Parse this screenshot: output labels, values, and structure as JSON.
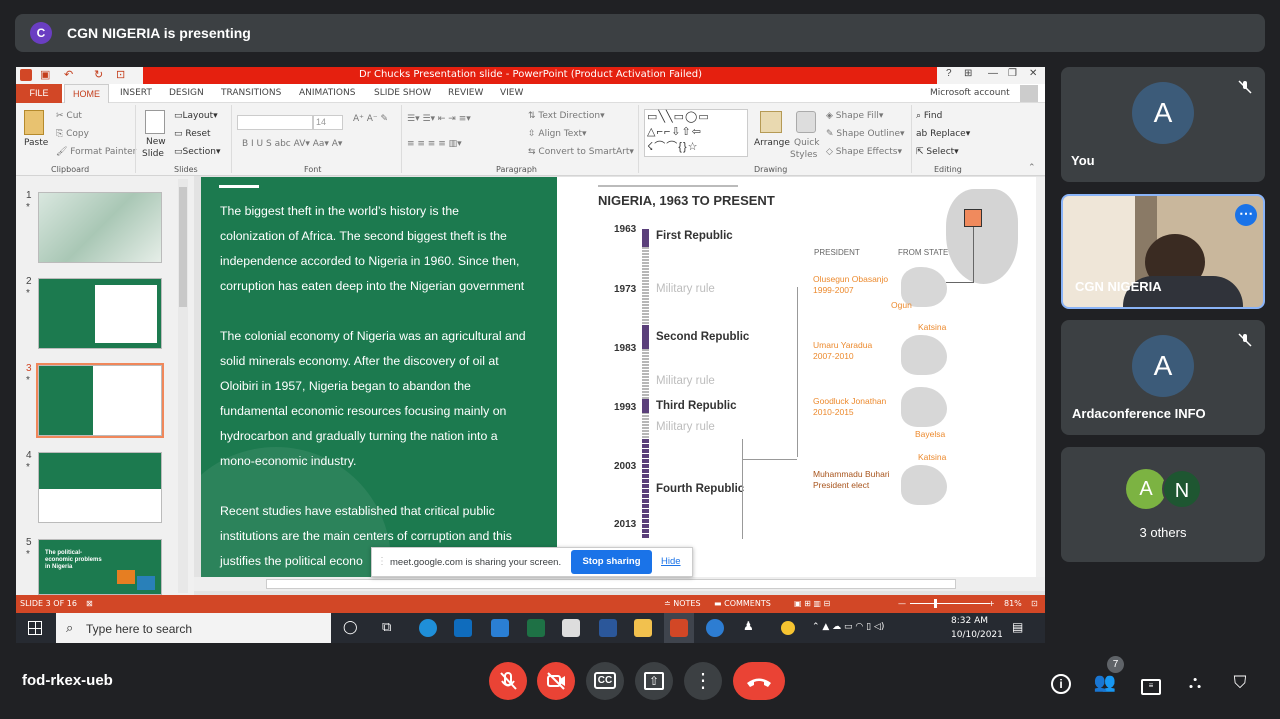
{
  "meet": {
    "presenter_initial": "C",
    "presenting_text": "CGN NIGERIA is presenting",
    "meeting_code": "fod-rkex-ueb",
    "participant_count": "7"
  },
  "participants": [
    {
      "initial": "A",
      "label": "You"
    },
    {
      "label": "CGN NIGERIA"
    },
    {
      "initial": "A",
      "label": "Ardaconference INFO"
    },
    {
      "initials": [
        "A",
        "N"
      ],
      "label": "3 others"
    }
  ],
  "ppt": {
    "window_title": "Dr Chucks Presentation slide -  PowerPoint (Product Activation Failed)",
    "account": "Microsoft account",
    "tabs": [
      "FILE",
      "HOME",
      "INSERT",
      "DESIGN",
      "TRANSITIONS",
      "ANIMATIONS",
      "SLIDE SHOW",
      "REVIEW",
      "VIEW"
    ],
    "ribbon": {
      "paste": "Paste",
      "cut": "Cut",
      "copy": "Copy",
      "format_painter": "Format Painter",
      "new_slide_1": "New",
      "new_slide_2": "Slide",
      "layout": "Layout",
      "reset": "Reset",
      "section": "Section",
      "font_size": "14",
      "text_direction": "Text Direction",
      "align_text": "Align Text",
      "convert_smartart": "Convert to SmartArt",
      "arrange": "Arrange",
      "quick_styles_1": "Quick",
      "quick_styles_2": "Styles",
      "shape_fill": "Shape Fill",
      "shape_outline": "Shape Outline",
      "shape_effects": "Shape Effects",
      "find": "Find",
      "replace": "Replace",
      "select": "Select",
      "groups": [
        "Clipboard",
        "Slides",
        "Font",
        "Paragraph",
        "Drawing",
        "Editing"
      ]
    },
    "thumbnails": [
      {
        "num": "1",
        "star": "*"
      },
      {
        "num": "2",
        "star": "*"
      },
      {
        "num": "3",
        "star": "*"
      },
      {
        "num": "4",
        "star": "*"
      },
      {
        "num": "5",
        "star": "*",
        "text": "The political-economic problems in Nigeria"
      }
    ],
    "slide": {
      "paragraph1": [
        "The biggest theft in the world’s history is the",
        "colonization of Africa. The second biggest theft is the",
        "independence accorded to Nigeria in 1960. Since then,",
        "corruption has eaten deep into the Nigerian government"
      ],
      "paragraph2": [
        "The colonial economy of Nigeria was an agricultural and",
        "solid minerals economy. After the discovery of oil at",
        "Oloibiri in 1957, Nigeria began to abandon the",
        "fundamental economic resources focusing mainly on",
        "hydrocarbon and gradually turning the nation into a",
        "mono-economic industry."
      ],
      "paragraph3": [
        "Recent studies have established that critical public",
        "institutions are the main centers of corruption and this",
        "justifies the political econo"
      ],
      "timeline_title": "NIGERIA, 1963 TO PRESENT",
      "years": [
        "1963",
        "1973",
        "1983",
        "1993",
        "2003",
        "2013"
      ],
      "eras": [
        "First Republic",
        "Military rule",
        "Second Republic",
        "Military rule",
        "Third Republic",
        "Military rule",
        "Fourth Republic"
      ],
      "col_president": "PRESIDENT",
      "col_state": "FROM STATE OF",
      "presidents": [
        {
          "name": "Olusegun Obasanjo",
          "years": "1999-2007",
          "state": "Ogun"
        },
        {
          "name": "Umaru Yaradua",
          "years": "2007-2010",
          "state": "Katsina"
        },
        {
          "name": "Goodluck Jonathan",
          "years": "2010-2015",
          "state": "Bayelsa"
        },
        {
          "name": "Muhammadu Buhari",
          "years": "President elect",
          "state": "Katsina"
        }
      ]
    },
    "toast": {
      "text": "meet.google.com is sharing your screen.",
      "stop": "Stop sharing",
      "hide": "Hide"
    },
    "status": {
      "slide": "SLIDE 3 OF 16",
      "notes": "NOTES",
      "comments": "COMMENTS",
      "zoom": "81%"
    },
    "taskbar": {
      "search": "Type here to search",
      "time": "8:32 AM",
      "date": "10/10/2021"
    }
  },
  "colors": {
    "ppt_red": "#d24726",
    "slide_green": "#1c7a4f",
    "meet_bg": "#202124",
    "end_call": "#ea4335",
    "stop_sharing": "#1a73e8"
  }
}
